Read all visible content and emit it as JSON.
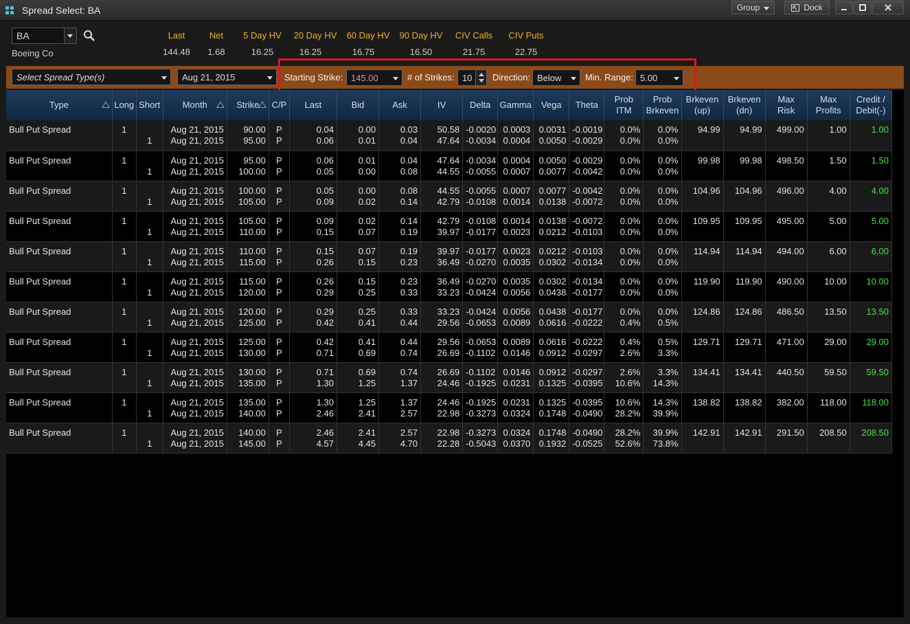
{
  "window": {
    "title": "Spread Select: BA",
    "group_label": "Group",
    "dock_label": "Dock",
    "colors": {
      "accent_orange": "#8b4a19",
      "header_blue": "#1d3a5c",
      "highlight_red": "#e0161e",
      "credit_green": "#3ee83e",
      "stat_label_yellow": "#f0b020"
    }
  },
  "symbol": {
    "value": "BA",
    "company": "Boeing Co"
  },
  "stats": [
    {
      "label": "Last",
      "value": "144.48"
    },
    {
      "label": "Net",
      "value": "1.68"
    },
    {
      "label": "5 Day HV",
      "value": "16.25"
    },
    {
      "label": "20 Day HV",
      "value": "16.25"
    },
    {
      "label": "60 Day HV",
      "value": "16.75"
    },
    {
      "label": "90 Day HV",
      "value": "16.50"
    },
    {
      "label": "CIV Calls",
      "value": "21.75"
    },
    {
      "label": "CIV Puts",
      "value": "22.75"
    }
  ],
  "controls": {
    "spread_type": "Select Spread Type(s)",
    "expiration": "Aug 21, 2015",
    "starting_strike_label": "Starting Strike:",
    "starting_strike": "145.00",
    "num_strikes_label": "# of Strikes:",
    "num_strikes": "10",
    "direction_label": "Direction:",
    "direction": "Below",
    "min_range_label": "Min. Range:",
    "min_range": "5.00"
  },
  "columns": [
    "Type",
    "Long",
    "Short",
    "Month",
    "Strike",
    "C/P",
    "Last",
    "Bid",
    "Ask",
    "IV",
    "Delta",
    "Gamma",
    "Vega",
    "Theta",
    "Prob\nITM",
    "Prob\nBrkeven",
    "Brkeven\n(up)",
    "Brkeven\n(dn)",
    "Max\nRisk",
    "Max\nProfits",
    "Credit /\nDebit(-)"
  ],
  "rows": [
    {
      "type": "Bull Put Spread",
      "long": "1",
      "short": "1",
      "month": [
        "Aug 21, 2015",
        "Aug 21, 2015"
      ],
      "strike": [
        "90.00",
        "95.00"
      ],
      "cp": [
        "P",
        "P"
      ],
      "last": [
        "0.04",
        "0.06"
      ],
      "bid": [
        "0.00",
        "0.01"
      ],
      "ask": [
        "0.03",
        "0.04"
      ],
      "iv": [
        "50.58",
        "47.64"
      ],
      "delta": [
        "-0.0020",
        "-0.0034"
      ],
      "gamma": [
        "0.0003",
        "0.0004"
      ],
      "vega": [
        "0.0031",
        "0.0050"
      ],
      "theta": [
        "-0.0019",
        "-0.0029"
      ],
      "prob_itm": [
        "0.0%",
        "0.0%"
      ],
      "prob_brkeven": [
        "0.0%",
        "0.0%"
      ],
      "brk_up": "94.99",
      "brk_dn": "94.99",
      "max_risk": "499.00",
      "max_profits": "1.00",
      "credit": "1.00"
    },
    {
      "type": "Bull Put Spread",
      "long": "1",
      "short": "1",
      "month": [
        "Aug 21, 2015",
        "Aug 21, 2015"
      ],
      "strike": [
        "95.00",
        "100.00"
      ],
      "cp": [
        "P",
        "P"
      ],
      "last": [
        "0.06",
        "0.05"
      ],
      "bid": [
        "0.01",
        "0.00"
      ],
      "ask": [
        "0.04",
        "0.08"
      ],
      "iv": [
        "47.64",
        "44.55"
      ],
      "delta": [
        "-0.0034",
        "-0.0055"
      ],
      "gamma": [
        "0.0004",
        "0.0007"
      ],
      "vega": [
        "0.0050",
        "0.0077"
      ],
      "theta": [
        "-0.0029",
        "-0.0042"
      ],
      "prob_itm": [
        "0.0%",
        "0.0%"
      ],
      "prob_brkeven": [
        "0.0%",
        "0.0%"
      ],
      "brk_up": "99.98",
      "brk_dn": "99.98",
      "max_risk": "498.50",
      "max_profits": "1.50",
      "credit": "1.50"
    },
    {
      "type": "Bull Put Spread",
      "long": "1",
      "short": "1",
      "month": [
        "Aug 21, 2015",
        "Aug 21, 2015"
      ],
      "strike": [
        "100.00",
        "105.00"
      ],
      "cp": [
        "P",
        "P"
      ],
      "last": [
        "0.05",
        "0.09"
      ],
      "bid": [
        "0.00",
        "0.02"
      ],
      "ask": [
        "0.08",
        "0.14"
      ],
      "iv": [
        "44.55",
        "42.79"
      ],
      "delta": [
        "-0.0055",
        "-0.0108"
      ],
      "gamma": [
        "0.0007",
        "0.0014"
      ],
      "vega": [
        "0.0077",
        "0.0138"
      ],
      "theta": [
        "-0.0042",
        "-0.0072"
      ],
      "prob_itm": [
        "0.0%",
        "0.0%"
      ],
      "prob_brkeven": [
        "0.0%",
        "0.0%"
      ],
      "brk_up": "104.96",
      "brk_dn": "104.96",
      "max_risk": "496.00",
      "max_profits": "4.00",
      "credit": "4.00"
    },
    {
      "type": "Bull Put Spread",
      "long": "1",
      "short": "1",
      "month": [
        "Aug 21, 2015",
        "Aug 21, 2015"
      ],
      "strike": [
        "105.00",
        "110.00"
      ],
      "cp": [
        "P",
        "P"
      ],
      "last": [
        "0.09",
        "0.15"
      ],
      "bid": [
        "0.02",
        "0.07"
      ],
      "ask": [
        "0.14",
        "0.19"
      ],
      "iv": [
        "42.79",
        "39.97"
      ],
      "delta": [
        "-0.0108",
        "-0.0177"
      ],
      "gamma": [
        "0.0014",
        "0.0023"
      ],
      "vega": [
        "0.0138",
        "0.0212"
      ],
      "theta": [
        "-0.0072",
        "-0.0103"
      ],
      "prob_itm": [
        "0.0%",
        "0.0%"
      ],
      "prob_brkeven": [
        "0.0%",
        "0.0%"
      ],
      "brk_up": "109.95",
      "brk_dn": "109.95",
      "max_risk": "495.00",
      "max_profits": "5.00",
      "credit": "5.00"
    },
    {
      "type": "Bull Put Spread",
      "long": "1",
      "short": "1",
      "month": [
        "Aug 21, 2015",
        "Aug 21, 2015"
      ],
      "strike": [
        "110.00",
        "115.00"
      ],
      "cp": [
        "P",
        "P"
      ],
      "last": [
        "0.15",
        "0.26"
      ],
      "bid": [
        "0.07",
        "0.15"
      ],
      "ask": [
        "0.19",
        "0.23"
      ],
      "iv": [
        "39.97",
        "36.49"
      ],
      "delta": [
        "-0.0177",
        "-0.0270"
      ],
      "gamma": [
        "0.0023",
        "0.0035"
      ],
      "vega": [
        "0.0212",
        "0.0302"
      ],
      "theta": [
        "-0.0103",
        "-0.0134"
      ],
      "prob_itm": [
        "0.0%",
        "0.0%"
      ],
      "prob_brkeven": [
        "0.0%",
        "0.0%"
      ],
      "brk_up": "114.94",
      "brk_dn": "114.94",
      "max_risk": "494.00",
      "max_profits": "6.00",
      "credit": "6.00"
    },
    {
      "type": "Bull Put Spread",
      "long": "1",
      "short": "1",
      "month": [
        "Aug 21, 2015",
        "Aug 21, 2015"
      ],
      "strike": [
        "115.00",
        "120.00"
      ],
      "cp": [
        "P",
        "P"
      ],
      "last": [
        "0.26",
        "0.29"
      ],
      "bid": [
        "0.15",
        "0.25"
      ],
      "ask": [
        "0.23",
        "0.33"
      ],
      "iv": [
        "36.49",
        "33.23"
      ],
      "delta": [
        "-0.0270",
        "-0.0424"
      ],
      "gamma": [
        "0.0035",
        "0.0056"
      ],
      "vega": [
        "0.0302",
        "0.0438"
      ],
      "theta": [
        "-0.0134",
        "-0.0177"
      ],
      "prob_itm": [
        "0.0%",
        "0.0%"
      ],
      "prob_brkeven": [
        "0.0%",
        "0.0%"
      ],
      "brk_up": "119.90",
      "brk_dn": "119.90",
      "max_risk": "490.00",
      "max_profits": "10.00",
      "credit": "10.00"
    },
    {
      "type": "Bull Put Spread",
      "long": "1",
      "short": "1",
      "month": [
        "Aug 21, 2015",
        "Aug 21, 2015"
      ],
      "strike": [
        "120.00",
        "125.00"
      ],
      "cp": [
        "P",
        "P"
      ],
      "last": [
        "0.29",
        "0.42"
      ],
      "bid": [
        "0.25",
        "0.41"
      ],
      "ask": [
        "0.33",
        "0.44"
      ],
      "iv": [
        "33.23",
        "29.56"
      ],
      "delta": [
        "-0.0424",
        "-0.0653"
      ],
      "gamma": [
        "0.0056",
        "0.0089"
      ],
      "vega": [
        "0.0438",
        "0.0616"
      ],
      "theta": [
        "-0.0177",
        "-0.0222"
      ],
      "prob_itm": [
        "0.0%",
        "0.4%"
      ],
      "prob_brkeven": [
        "0.0%",
        "0.5%"
      ],
      "brk_up": "124.86",
      "brk_dn": "124.86",
      "max_risk": "486.50",
      "max_profits": "13.50",
      "credit": "13.50"
    },
    {
      "type": "Bull Put Spread",
      "long": "1",
      "short": "1",
      "month": [
        "Aug 21, 2015",
        "Aug 21, 2015"
      ],
      "strike": [
        "125.00",
        "130.00"
      ],
      "cp": [
        "P",
        "P"
      ],
      "last": [
        "0.42",
        "0.71"
      ],
      "bid": [
        "0.41",
        "0.69"
      ],
      "ask": [
        "0.44",
        "0.74"
      ],
      "iv": [
        "29.56",
        "26.69"
      ],
      "delta": [
        "-0.0653",
        "-0.1102"
      ],
      "gamma": [
        "0.0089",
        "0.0146"
      ],
      "vega": [
        "0.0616",
        "0.0912"
      ],
      "theta": [
        "-0.0222",
        "-0.0297"
      ],
      "prob_itm": [
        "0.4%",
        "2.6%"
      ],
      "prob_brkeven": [
        "0.5%",
        "3.3%"
      ],
      "brk_up": "129.71",
      "brk_dn": "129.71",
      "max_risk": "471.00",
      "max_profits": "29.00",
      "credit": "29.00"
    },
    {
      "type": "Bull Put Spread",
      "long": "1",
      "short": "1",
      "month": [
        "Aug 21, 2015",
        "Aug 21, 2015"
      ],
      "strike": [
        "130.00",
        "135.00"
      ],
      "cp": [
        "P",
        "P"
      ],
      "last": [
        "0.71",
        "1.30"
      ],
      "bid": [
        "0.69",
        "1.25"
      ],
      "ask": [
        "0.74",
        "1.37"
      ],
      "iv": [
        "26.69",
        "24.46"
      ],
      "delta": [
        "-0.1102",
        "-0.1925"
      ],
      "gamma": [
        "0.0146",
        "0.0231"
      ],
      "vega": [
        "0.0912",
        "0.1325"
      ],
      "theta": [
        "-0.0297",
        "-0.0395"
      ],
      "prob_itm": [
        "2.6%",
        "10.6%"
      ],
      "prob_brkeven": [
        "3.3%",
        "14.3%"
      ],
      "brk_up": "134.41",
      "brk_dn": "134.41",
      "max_risk": "440.50",
      "max_profits": "59.50",
      "credit": "59.50"
    },
    {
      "type": "Bull Put Spread",
      "long": "1",
      "short": "1",
      "month": [
        "Aug 21, 2015",
        "Aug 21, 2015"
      ],
      "strike": [
        "135.00",
        "140.00"
      ],
      "cp": [
        "P",
        "P"
      ],
      "last": [
        "1.30",
        "2.46"
      ],
      "bid": [
        "1.25",
        "2.41"
      ],
      "ask": [
        "1.37",
        "2.57"
      ],
      "iv": [
        "24.46",
        "22.98"
      ],
      "delta": [
        "-0.1925",
        "-0.3273"
      ],
      "gamma": [
        "0.0231",
        "0.0324"
      ],
      "vega": [
        "0.1325",
        "0.1748"
      ],
      "theta": [
        "-0.0395",
        "-0.0490"
      ],
      "prob_itm": [
        "10.6%",
        "28.2%"
      ],
      "prob_brkeven": [
        "14.3%",
        "39.9%"
      ],
      "brk_up": "138.82",
      "brk_dn": "138.82",
      "max_risk": "382.00",
      "max_profits": "118.00",
      "credit": "118.00"
    },
    {
      "type": "Bull Put Spread",
      "long": "1",
      "short": "1",
      "month": [
        "Aug 21, 2015",
        "Aug 21, 2015"
      ],
      "strike": [
        "140.00",
        "145.00"
      ],
      "cp": [
        "P",
        "P"
      ],
      "last": [
        "2.46",
        "4.57"
      ],
      "bid": [
        "2.41",
        "4.45"
      ],
      "ask": [
        "2.57",
        "4.70"
      ],
      "iv": [
        "22.98",
        "22.28"
      ],
      "delta": [
        "-0.3273",
        "-0.5043"
      ],
      "gamma": [
        "0.0324",
        "0.0370"
      ],
      "vega": [
        "0.1748",
        "0.1932"
      ],
      "theta": [
        "-0.0490",
        "-0.0525"
      ],
      "prob_itm": [
        "28.2%",
        "52.6%"
      ],
      "prob_brkeven": [
        "39.9%",
        "73.8%"
      ],
      "brk_up": "142.91",
      "brk_dn": "142.91",
      "max_risk": "291.50",
      "max_profits": "208.50",
      "credit": "208.50"
    }
  ]
}
